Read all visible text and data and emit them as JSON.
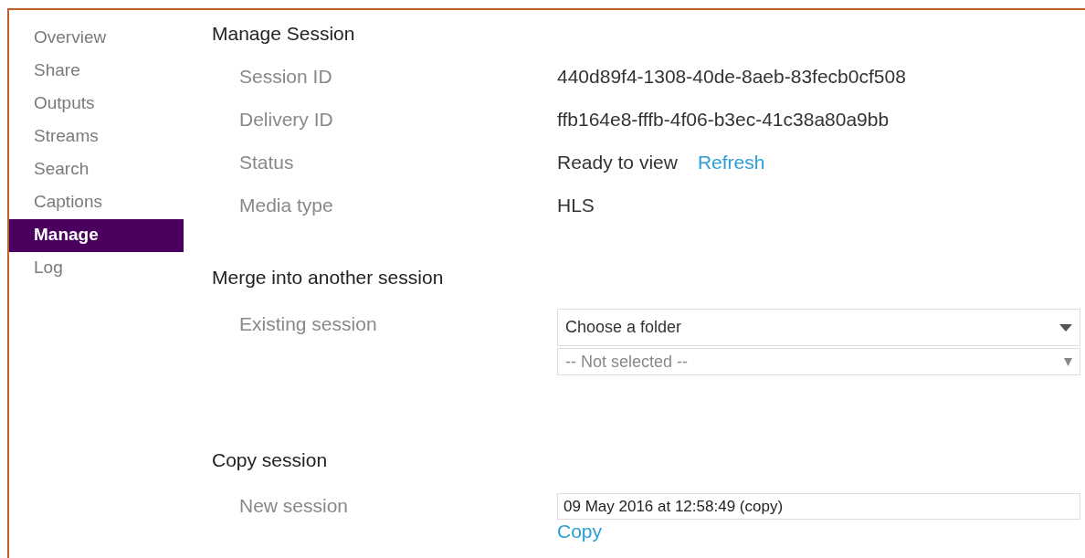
{
  "sidebar": {
    "items": [
      {
        "label": "Overview",
        "selected": false
      },
      {
        "label": "Share",
        "selected": false
      },
      {
        "label": "Outputs",
        "selected": false
      },
      {
        "label": "Streams",
        "selected": false
      },
      {
        "label": "Search",
        "selected": false
      },
      {
        "label": "Captions",
        "selected": false
      },
      {
        "label": "Manage",
        "selected": true
      },
      {
        "label": "Log",
        "selected": false
      }
    ]
  },
  "sections": [
    {
      "title": "Manage Session",
      "rows": [
        {
          "kind": "info",
          "label": "Session ID",
          "value": "440d89f4-1308-40de-8aeb-83fecb0cf508"
        },
        {
          "kind": "info",
          "label": "Delivery ID",
          "value": "ffb164e8-fffb-4f06-b3ec-41c38a80a9bb"
        },
        {
          "kind": "info",
          "label": "Status",
          "value": "Ready to view",
          "link": "Refresh"
        },
        {
          "kind": "info",
          "label": "Media type",
          "value": "HLS"
        }
      ]
    },
    {
      "title": "Merge into another session",
      "rows": [
        {
          "kind": "select",
          "label": "Existing session",
          "folder": "Choose a folder",
          "session_placeholder": "-- Not selected --"
        }
      ]
    },
    {
      "title": "Copy session",
      "rows": [
        {
          "kind": "input",
          "label": "New session",
          "value": "09 May 2016 at 12:58:49 (copy)",
          "link": "Copy"
        }
      ]
    }
  ]
}
